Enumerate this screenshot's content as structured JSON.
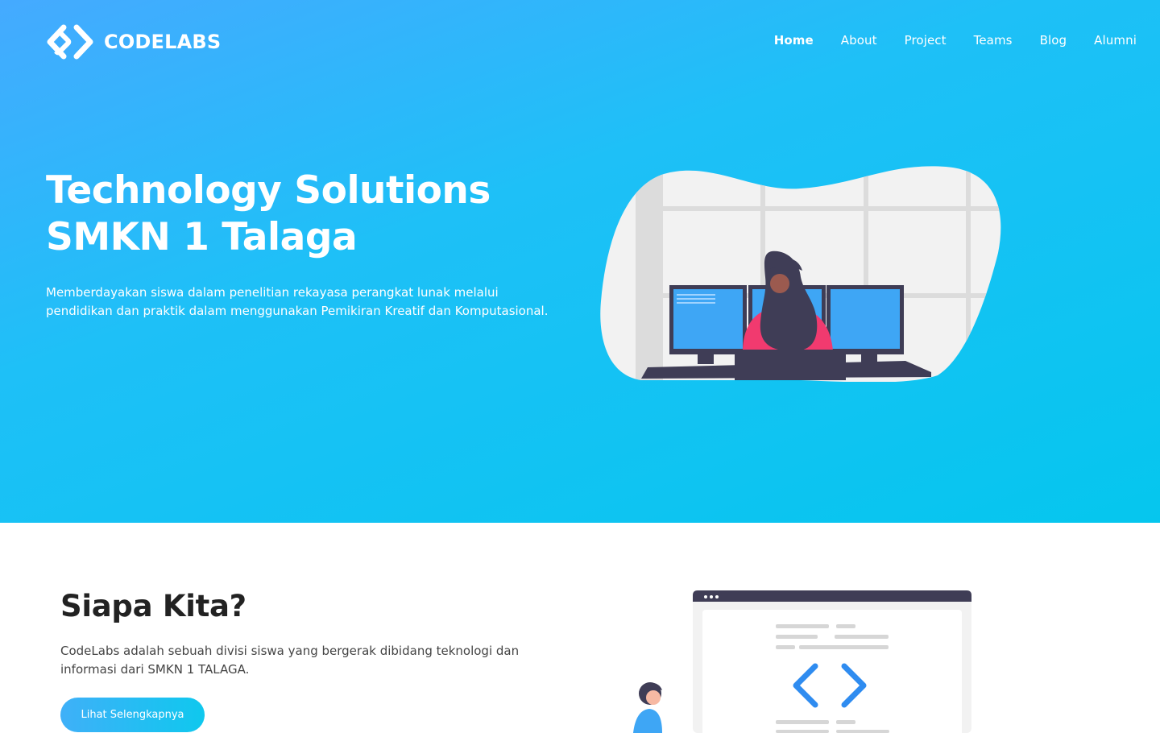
{
  "brand": {
    "name": "CODELABS",
    "logo_icon": "code-brackets-icon"
  },
  "nav": {
    "items": [
      {
        "label": "Home",
        "active": true
      },
      {
        "label": "About",
        "active": false
      },
      {
        "label": "Project",
        "active": false
      },
      {
        "label": "Teams",
        "active": false
      },
      {
        "label": "Blog",
        "active": false
      },
      {
        "label": "Alumni",
        "active": false
      }
    ]
  },
  "hero": {
    "title_line1": "Technology Solutions",
    "title_line2": "SMKN 1 Talaga",
    "subtitle_line1": "Memberdayakan siswa dalam penelitian rekayasa perangkat lunak melalui",
    "subtitle_line2": "pendidikan dan praktik dalam menggunakan Pemikiran Kreatif dan Komputasional.",
    "illustration": "woman-at-monitors-illustration"
  },
  "about": {
    "title": "Siapa Kita?",
    "text_line1": "CodeLabs adalah sebuah divisi siswa yang bergerak dibidang teknologi dan",
    "text_line2": "informasi dari SMKN 1 TALAGA.",
    "button_label": "Lihat Selengkapnya",
    "illustration": "developer-browser-illustration"
  },
  "colors": {
    "hero_gradient_start": "#45aaff",
    "hero_gradient_end": "#05c6ee",
    "button_gradient_start": "#3fb0f8",
    "button_gradient_end": "#0fc8ee",
    "code_icon_blue": "#2f8cf0",
    "illustration_dark": "#3f3d56",
    "illustration_pink": "#f13a6f"
  }
}
